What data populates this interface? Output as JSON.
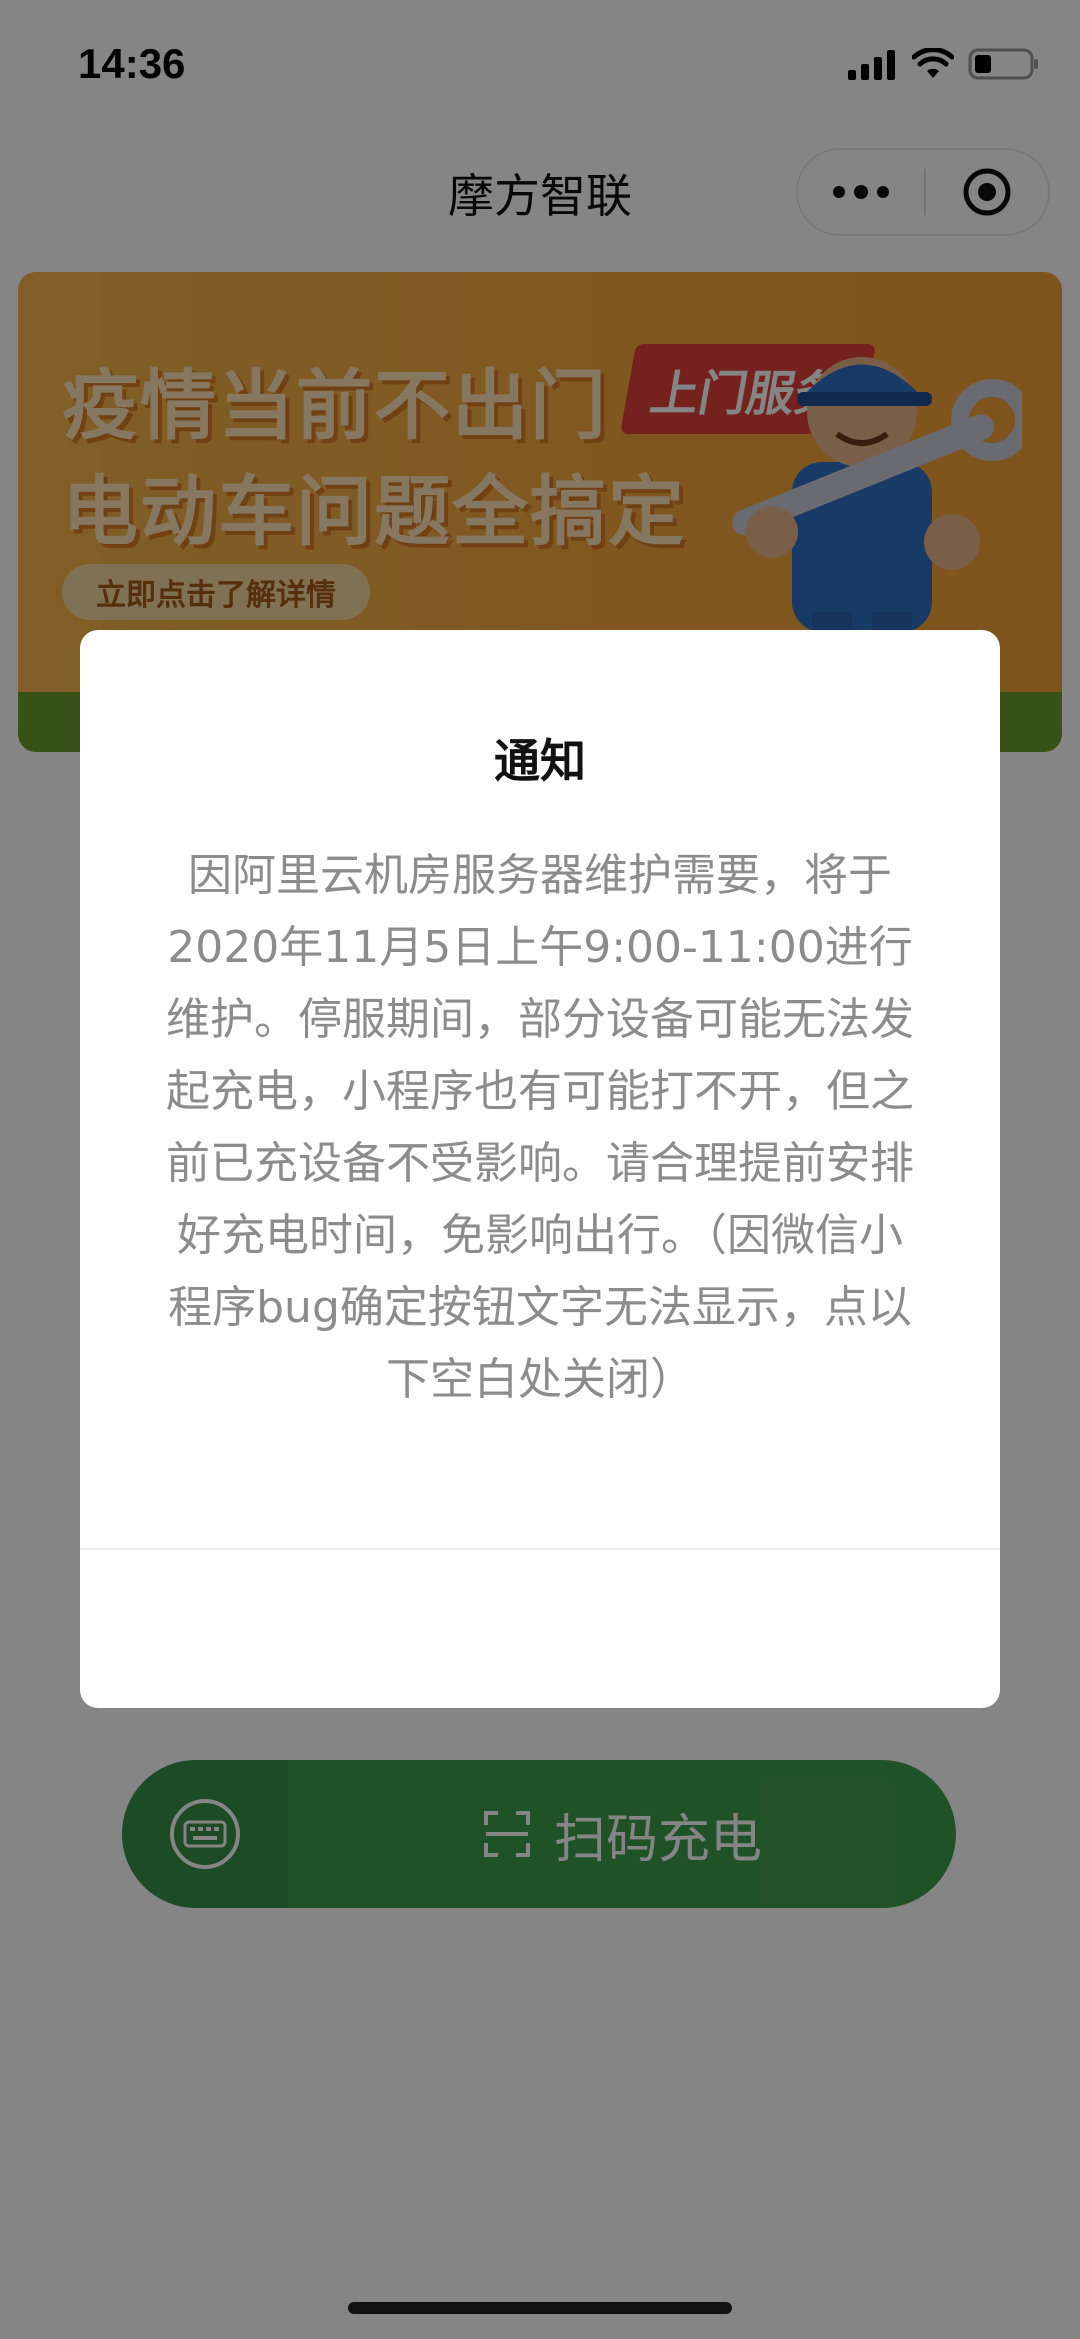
{
  "status_bar": {
    "time": "14:36",
    "icons": [
      "signal-icon",
      "wifi-icon",
      "battery-icon"
    ]
  },
  "nav": {
    "title": "摩方智联",
    "capsule_icons": [
      "more-icon",
      "close-miniprogram-icon"
    ]
  },
  "banner": {
    "line1": "疫情当前不出门",
    "tag": "上门服务",
    "line2": "电动车问题全搞定",
    "cta": "立即点击了解详情"
  },
  "modal": {
    "title": "通知",
    "body": "因阿里云机房服务器维护需要，将于2020年11月5日上午9:00-11:00进行维护。停服期间，部分设备可能无法发起充电，小程序也有可能打不开，但之前已充设备不受影响。请合理提前安排好充电时间，免影响出行。（因微信小程序bug确定按钮文字无法显示，点以下空白处关闭）"
  },
  "scan": {
    "label": "扫码充电",
    "left_icon": "keyboard-icon",
    "scan_icon": "scan-icon"
  },
  "colors": {
    "banner_orange": "#f5a93c",
    "scan_green": "#3f9e4c",
    "overlay": "rgba(0,0,0,0.48)"
  }
}
